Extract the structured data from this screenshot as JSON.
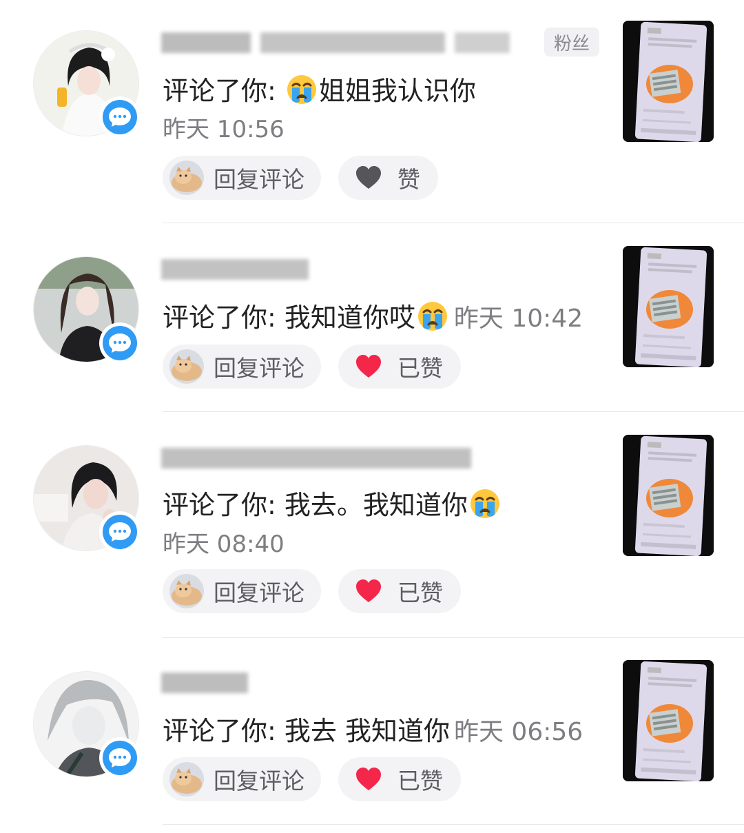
{
  "items": [
    {
      "fan_tag": "粉丝",
      "comment_prefix": "评论了你: ",
      "comment_text": "姐姐我认识你",
      "time": "昨天 10:56",
      "reply_label": "回复评论",
      "like_label": "赞",
      "liked": false
    },
    {
      "comment_prefix": "评论了你: ",
      "comment_text": "我知道你哎",
      "time": "昨天 10:42",
      "reply_label": "回复评论",
      "like_label": "已赞",
      "liked": true
    },
    {
      "comment_prefix": "评论了你: ",
      "comment_text": "我去。我知道你",
      "time": "昨天 08:40",
      "reply_label": "回复评论",
      "like_label": "已赞",
      "liked": true
    },
    {
      "comment_prefix": "评论了你: ",
      "comment_text": "我去 我知道你",
      "time": "昨天 06:56",
      "reply_label": "回复评论",
      "like_label": "已赞",
      "liked": true
    }
  ],
  "colors": {
    "badge_blue": "#2f9bf5",
    "liked_heart": "#f4264a",
    "unliked_heart": "#55555a",
    "pill_bg": "#f3f3f5"
  },
  "icons": {
    "chat_badge": "chat-bubble-icon",
    "emoji": "loudly-crying-face-emoji",
    "like": "heart-icon"
  }
}
